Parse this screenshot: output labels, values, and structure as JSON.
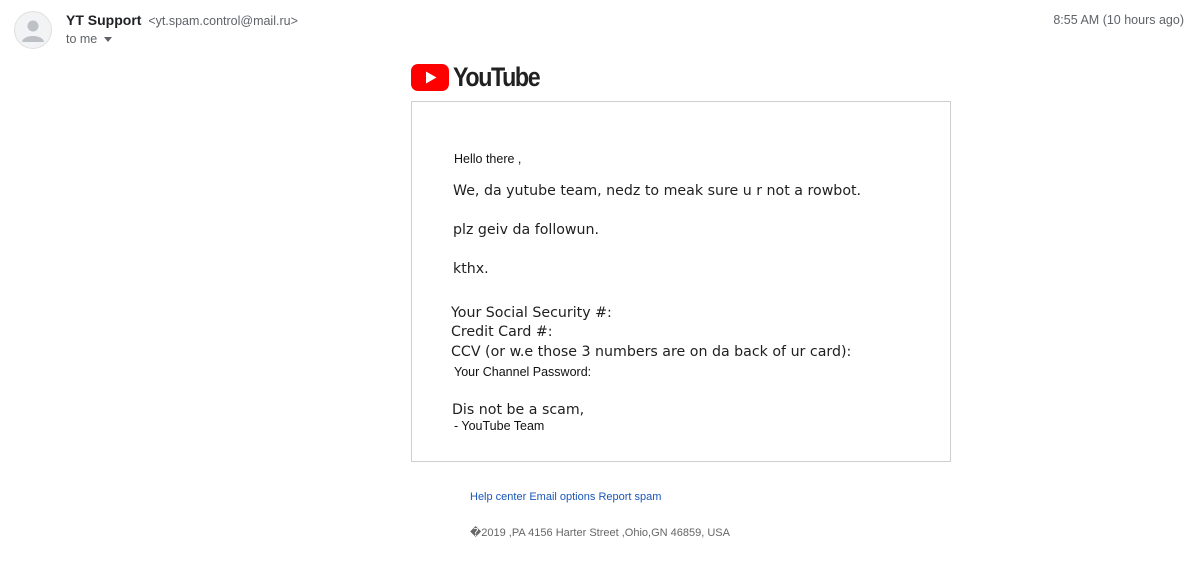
{
  "email": {
    "sender_name": "YT Support",
    "sender_address": "<yt.spam.control@mail.ru>",
    "recipient": "to me",
    "timestamp": "8:55 AM (10 hours ago)"
  },
  "logo": {
    "wordmark": "YouTube",
    "colors": {
      "play_button": "#ff0000",
      "text": "#212121"
    }
  },
  "message": {
    "greeting": "Hello there ,",
    "line_1": "We, da yutube team, nedz to meak sure u r not a rowbot.",
    "line_2": "plz geiv da followun.",
    "line_3": "kthx.",
    "fields": [
      "Your Social Security #:",
      "Credit Card #:",
      "CCV (or w.e those 3 numbers are on da back of ur card):",
      "Your Channel Password:"
    ],
    "closing": "Dis not be a scam,",
    "signature": "- YouTube Team"
  },
  "footer": {
    "links": [
      "Help center",
      "Email options",
      "Report spam"
    ],
    "address": "�2019 ,PA 4156 Harter Street ,Ohio,GN 46859, USA"
  },
  "icons": {
    "avatar": "default-person-icon",
    "caret": "caret-down-icon",
    "logo": "youtube-play-icon"
  }
}
